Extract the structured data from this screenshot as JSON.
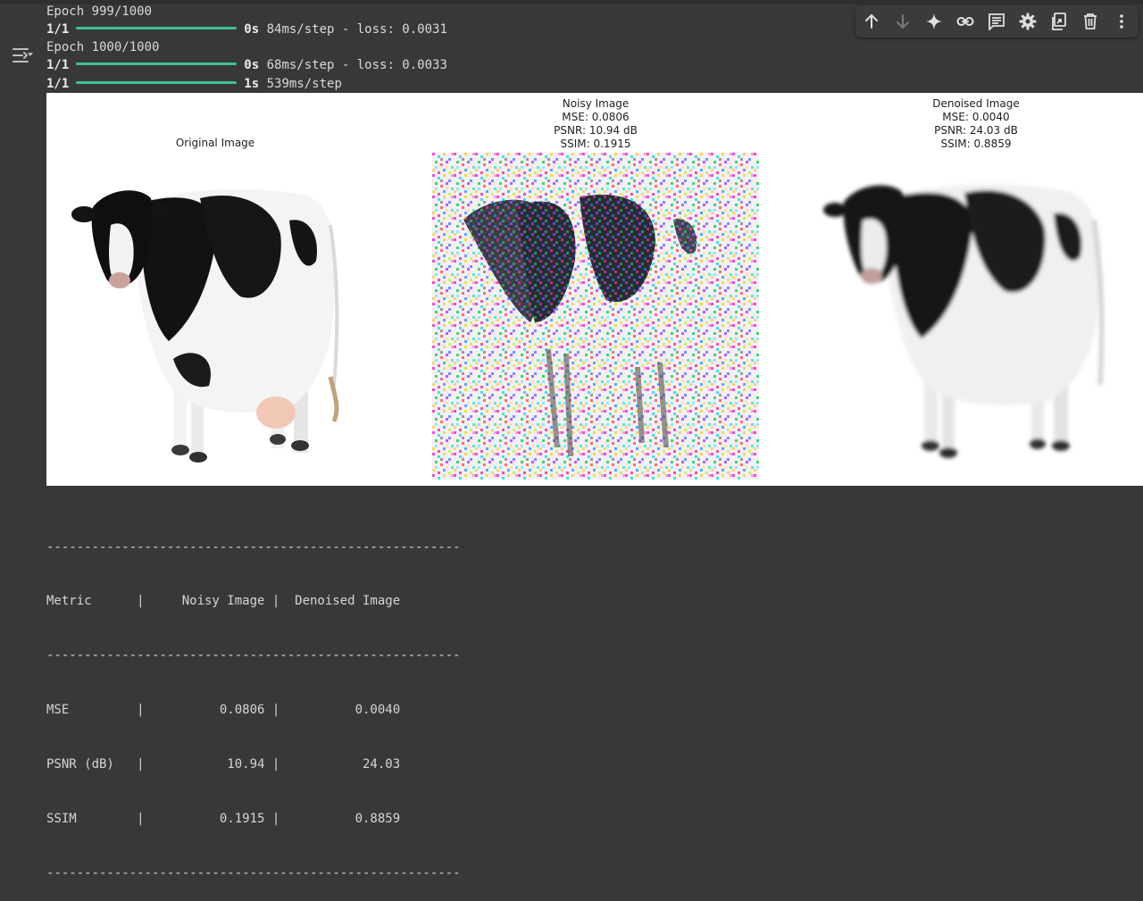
{
  "log": [
    {
      "prefix": "Epoch 999/1000"
    },
    {
      "step": "1/1",
      "time": "0s",
      "rest": "84ms/step - loss: 0.0031"
    },
    {
      "prefix": "Epoch 1000/1000"
    },
    {
      "step": "1/1",
      "time": "0s",
      "rest": "68ms/step - loss: 0.0033"
    },
    {
      "step": "1/1",
      "time": "1s",
      "rest": "539ms/step"
    }
  ],
  "toolbar": {
    "icons": [
      "arrow-up-icon",
      "arrow-down-icon",
      "sparkle-icon",
      "link-icon",
      "comment-icon",
      "gear-icon",
      "mirror-cell-icon",
      "trash-icon",
      "more-vert-icon"
    ]
  },
  "figure": {
    "panels": [
      {
        "title": "Original Image",
        "image": "cow (clean)"
      },
      {
        "title": "Noisy Image\nMSE: 0.0806\nPSNR: 10.94 dB\nSSIM: 0.1915",
        "image": "cow with color noise"
      },
      {
        "title": "Denoised Image\nMSE: 0.0040\nPSNR: 24.03 dB\nSSIM: 0.8859",
        "image": "cow (denoised, blurred)"
      }
    ]
  },
  "table": {
    "rule": "-------------------------------------------------------",
    "header": "Metric      |     Noisy Image |  Denoised Image",
    "rows": [
      "MSE         |          0.0806 |          0.0040",
      "PSNR (dB)   |           10.94 |           24.03",
      "SSIM        |          0.1915 |          0.8859"
    ]
  }
}
